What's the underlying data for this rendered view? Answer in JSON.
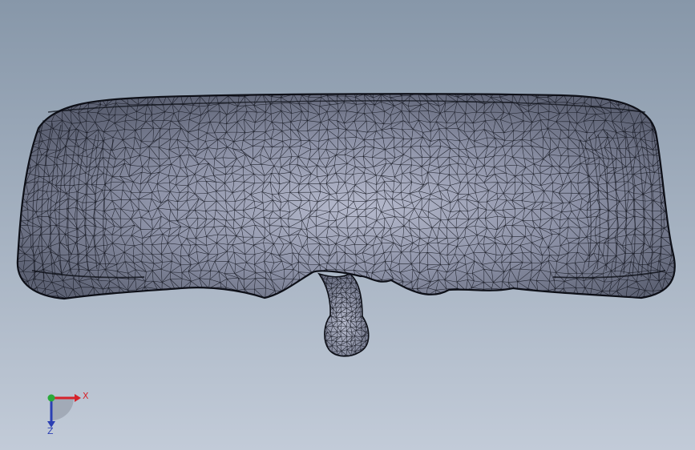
{
  "viewport": {
    "background_top": "#8797a9",
    "background_bottom": "#c2cbd8"
  },
  "model": {
    "surface_color": "#5d6274",
    "highlight_color": "#b5b9cc",
    "mesh_color": "#0d0f17"
  },
  "triad": {
    "x_label": "X",
    "z_label": "Z",
    "x_color": "#d6232b",
    "y_color": "#2aaa3a",
    "z_color": "#2b3fb3"
  }
}
